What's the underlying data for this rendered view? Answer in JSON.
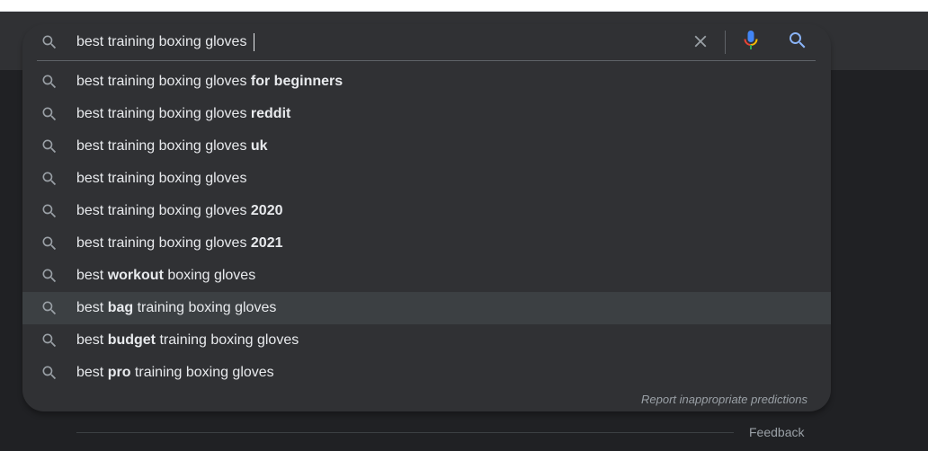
{
  "search": {
    "query": "best training boxing gloves ",
    "icons": {
      "lead": "search-icon",
      "clear": "close-icon",
      "voice": "microphone-icon",
      "submit": "search-icon"
    }
  },
  "suggestions": [
    {
      "pre": "best training boxing gloves ",
      "bold": "for beginners",
      "post": ""
    },
    {
      "pre": "best training boxing gloves ",
      "bold": "reddit",
      "post": ""
    },
    {
      "pre": "best training boxing gloves ",
      "bold": "uk",
      "post": ""
    },
    {
      "pre": "best training boxing gloves",
      "bold": "",
      "post": ""
    },
    {
      "pre": "best training boxing gloves ",
      "bold": "2020",
      "post": ""
    },
    {
      "pre": "best training boxing gloves ",
      "bold": "2021",
      "post": ""
    },
    {
      "pre": "best ",
      "bold": "workout",
      "post": " boxing gloves"
    },
    {
      "pre": "best ",
      "bold": "bag",
      "post": " training boxing gloves"
    },
    {
      "pre": "best ",
      "bold": "budget",
      "post": " training boxing gloves"
    },
    {
      "pre": "best ",
      "bold": "pro",
      "post": " training boxing gloves"
    }
  ],
  "highlighted_index": 7,
  "report_link": "Report inappropriate predictions",
  "footer": {
    "feedback": "Feedback"
  },
  "colors": {
    "page_background": "#202124",
    "dropdown_background": "#303134",
    "highlight_row": "#3c4043",
    "text": "#e8eaed",
    "muted_text": "#9aa0a6",
    "icon_gray": "#9aa0a6",
    "search_blue": "#8ab4f8",
    "mic_blue": "#4285f4",
    "mic_red": "#ea4335",
    "mic_yellow": "#fbbc04",
    "mic_green": "#34a853"
  }
}
